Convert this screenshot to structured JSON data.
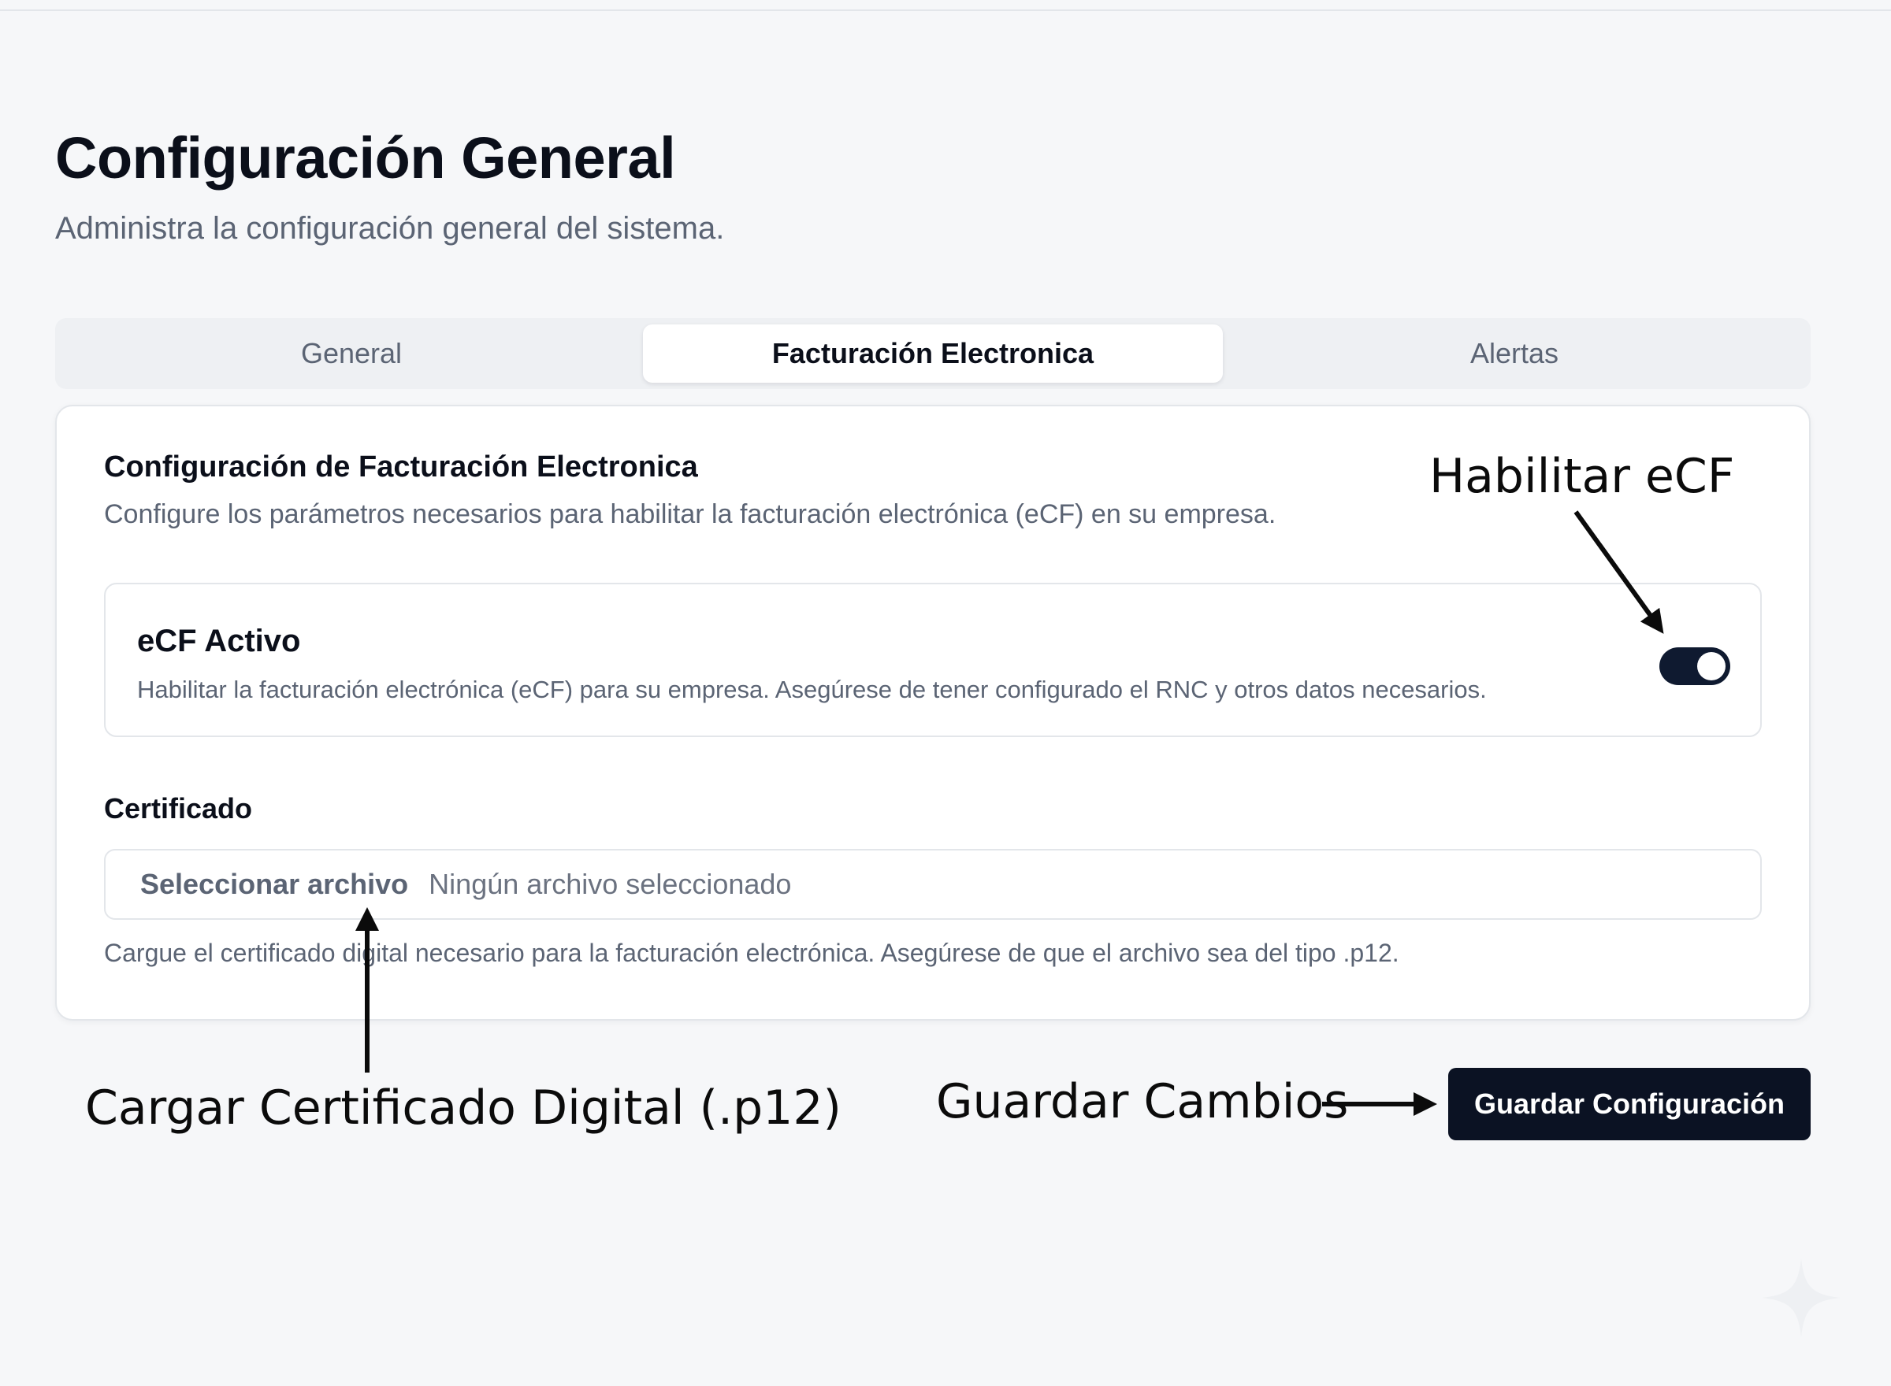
{
  "page": {
    "title": "Configuración General",
    "subtitle": "Administra la configuración general del sistema."
  },
  "tabs": [
    {
      "label": "General",
      "active": false
    },
    {
      "label": "Facturación Electronica",
      "active": true
    },
    {
      "label": "Alertas",
      "active": false
    }
  ],
  "card": {
    "title": "Configuración de Facturación Electronica",
    "description": "Configure los parámetros necesarios para habilitar la facturación electrónica (eCF) en su empresa."
  },
  "ecf_toggle": {
    "label": "eCF Activo",
    "help": "Habilitar la facturación electrónica (eCF) para su empresa. Asegúrese de tener configurado el RNC y otros datos necesarios.",
    "checked": true
  },
  "certificate": {
    "label": "Certificado",
    "button_label": "Seleccionar archivo",
    "status": "Ningún archivo seleccionado",
    "help": "Cargue el certificado digital necesario para la facturación electrónica. Asegúrese de que el archivo sea del tipo .p12."
  },
  "actions": {
    "save_label": "Guardar Configuración"
  },
  "annotations": {
    "ecf": "Habilitar eCF",
    "certificate": "Cargar Certificado Digital (.p12)",
    "save": "Guardar Cambios"
  },
  "colors": {
    "primary": "#0b1223",
    "background": "#f6f7f9",
    "muted_text": "#5b6474",
    "border": "#e3e6ea"
  }
}
